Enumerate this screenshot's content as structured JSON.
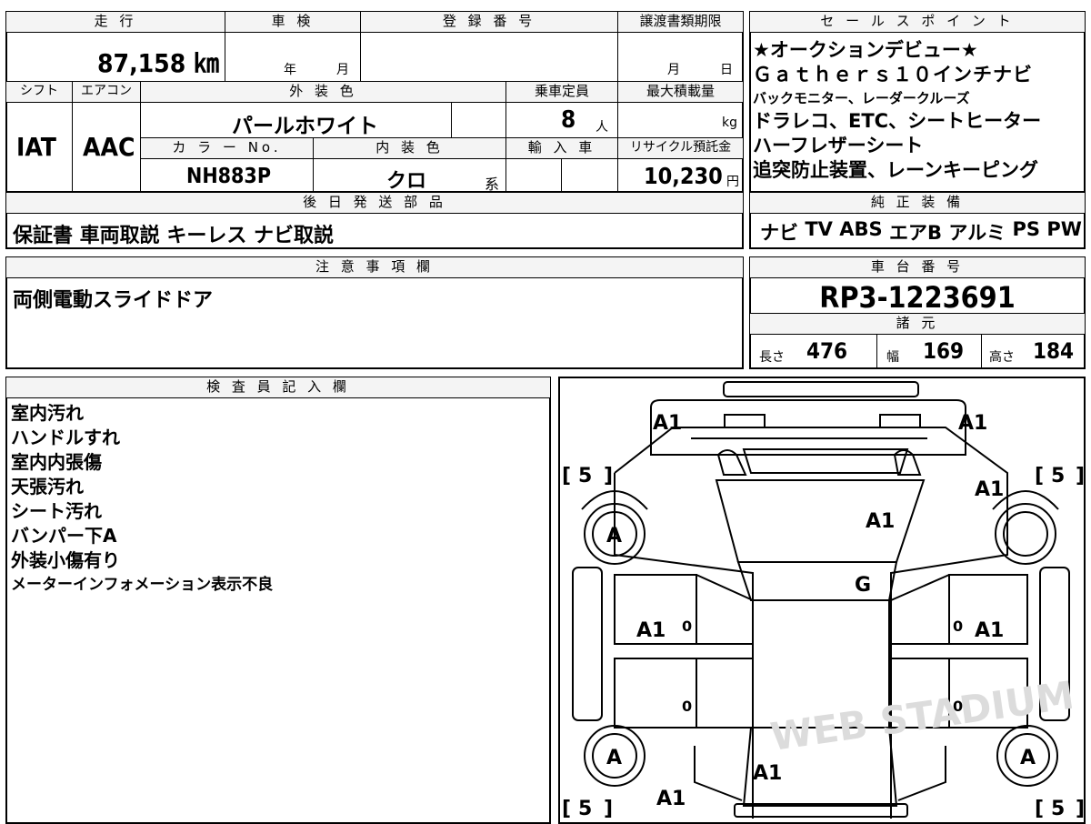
{
  "mileage": {
    "header": "走 行",
    "value": "87,158 ㎞"
  },
  "shaken": {
    "header": "車 検",
    "year": "年",
    "month": "月"
  },
  "registration": {
    "header": "登 録 番 号",
    "value": ""
  },
  "transfer": {
    "header": "譲渡書類期限",
    "month": "月",
    "day": "日"
  },
  "shift": {
    "header": "シフト",
    "value": "IAT"
  },
  "aircon": {
    "header": "エアコン",
    "value": "AAC"
  },
  "exterior": {
    "header": "外 装 色",
    "value": "パールホワイト"
  },
  "capacity": {
    "header": "乗車定員",
    "value": "8",
    "unit": "人"
  },
  "max_load": {
    "header": "最大積載量",
    "value": "",
    "unit": "kg"
  },
  "color_no": {
    "header": "カ ラ ー No.",
    "value": "NH883P"
  },
  "interior": {
    "header": "内 装 色",
    "value": "クロ",
    "suffix": "系"
  },
  "import": {
    "header": "輸 入 車"
  },
  "recycle": {
    "header": "リサイクル預託金",
    "value": "10,230",
    "unit": "円"
  },
  "later_parts": {
    "header": "後 日 発 送 部 品",
    "value": "保証書 車両取説 キーレス ナビ取説"
  },
  "sales_points": {
    "header": "セ ー ル ス ポ イ ン ト",
    "lines": [
      "★オークションデビュー★",
      "Ｇａｔｈｅｒｓ１０インチナビ",
      "バックモニター、レーダークルーズ",
      "ドラレコ、ETC、シートヒーター",
      "ハーフレザーシート",
      "追突防止装置、レーンキーピング"
    ]
  },
  "equipment": {
    "header": "純 正 装 備",
    "items": [
      "ナビ",
      "TV",
      "ABS",
      "エアB",
      "アルミ",
      "PS",
      "PW"
    ]
  },
  "notes": {
    "header": "注 意 事 項 欄",
    "value": "両側電動スライドドア"
  },
  "chassis": {
    "header": "車 台 番 号",
    "value": "RP3-1223691"
  },
  "specs": {
    "header": "諸 元",
    "length_label": "長さ",
    "length": "476",
    "width_label": "幅",
    "width": "169",
    "height_label": "高さ",
    "height": "184"
  },
  "inspector": {
    "header": "検 査 員 記 入 欄",
    "lines": [
      "室内汚れ",
      "ハンドルすれ",
      "室内内張傷",
      "天張汚れ",
      "シート汚れ",
      "バンパー下A",
      "外装小傷有り",
      "メーターインフォメーション表示不良"
    ]
  },
  "diagram": {
    "a1": "A1",
    "g": "G",
    "a": "A",
    "five": "5",
    "bl": "[",
    "br": "]",
    "zero": "0",
    "watermark": "WEB STADIUM"
  }
}
